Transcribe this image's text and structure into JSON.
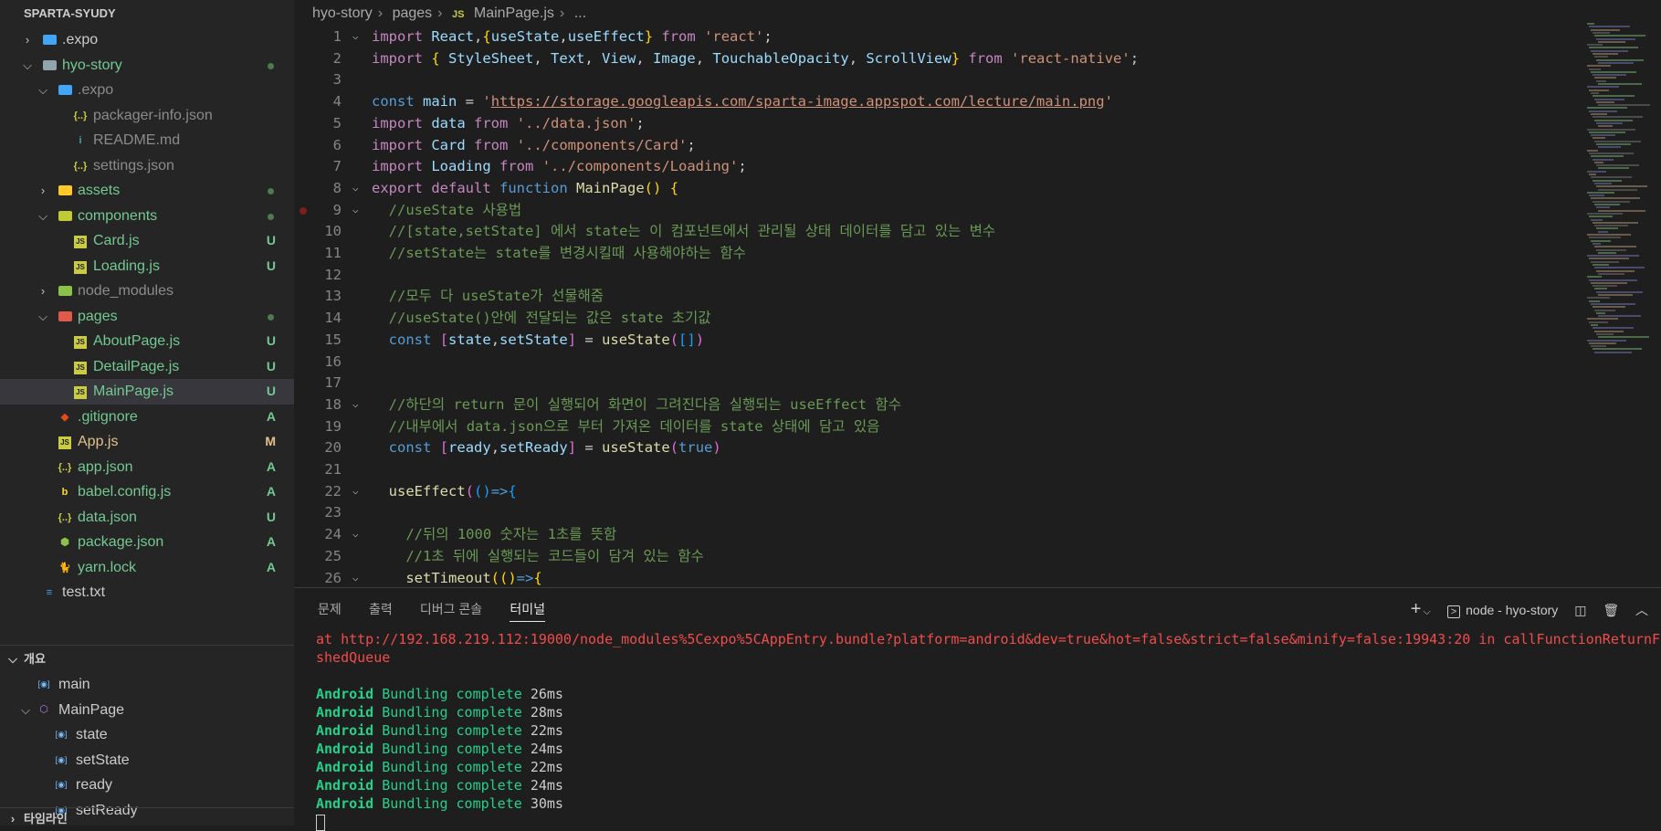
{
  "explorer": {
    "title": "SPARTA-SYUDY",
    "items": [
      {
        "label": ".expo",
        "depth": 1,
        "type": "folder",
        "open": false,
        "color": "white",
        "icon": "expo-folder-icon"
      },
      {
        "label": "hyo-story",
        "depth": 1,
        "type": "folder",
        "open": true,
        "color": "green",
        "dot": true,
        "icon": "folder-icon"
      },
      {
        "label": ".expo",
        "depth": 2,
        "type": "folder",
        "open": true,
        "color": "gray",
        "icon": "expo-folder-icon"
      },
      {
        "label": "packager-info.json",
        "depth": 3,
        "type": "file",
        "color": "gray",
        "icon": "json-icon",
        "glyph": "{..}"
      },
      {
        "label": "README.md",
        "depth": 3,
        "type": "file",
        "color": "gray",
        "icon": "info-icon",
        "glyph": "i"
      },
      {
        "label": "settings.json",
        "depth": 3,
        "type": "file",
        "color": "gray",
        "icon": "json-icon",
        "glyph": "{..}"
      },
      {
        "label": "assets",
        "depth": 2,
        "type": "folder",
        "open": false,
        "color": "green",
        "dot": true,
        "icon": "assets-folder-icon"
      },
      {
        "label": "components",
        "depth": 2,
        "type": "folder",
        "open": true,
        "color": "green",
        "dot": true,
        "icon": "components-folder-icon"
      },
      {
        "label": "Card.js",
        "depth": 3,
        "type": "file",
        "color": "green",
        "status": "U",
        "icon": "js-icon",
        "glyph": "JS"
      },
      {
        "label": "Loading.js",
        "depth": 3,
        "type": "file",
        "color": "green",
        "status": "U",
        "icon": "js-icon",
        "glyph": "JS"
      },
      {
        "label": "node_modules",
        "depth": 2,
        "type": "folder",
        "open": false,
        "color": "gray",
        "icon": "node-modules-folder-icon"
      },
      {
        "label": "pages",
        "depth": 2,
        "type": "folder",
        "open": true,
        "color": "green",
        "dot": true,
        "icon": "pages-folder-icon"
      },
      {
        "label": "AboutPage.js",
        "depth": 3,
        "type": "file",
        "color": "green",
        "status": "U",
        "icon": "js-icon",
        "glyph": "JS"
      },
      {
        "label": "DetailPage.js",
        "depth": 3,
        "type": "file",
        "color": "green",
        "status": "U",
        "icon": "js-icon",
        "glyph": "JS"
      },
      {
        "label": "MainPage.js",
        "depth": 3,
        "type": "file",
        "color": "green",
        "status": "U",
        "icon": "js-icon",
        "glyph": "JS",
        "selected": true
      },
      {
        "label": ".gitignore",
        "depth": 2,
        "type": "file",
        "color": "green",
        "status": "A",
        "icon": "git-icon",
        "glyph": "◆"
      },
      {
        "label": "App.js",
        "depth": 2,
        "type": "file",
        "color": "amber",
        "status": "M",
        "icon": "js-icon",
        "glyph": "JS"
      },
      {
        "label": "app.json",
        "depth": 2,
        "type": "file",
        "color": "green",
        "status": "A",
        "icon": "json-icon",
        "glyph": "{..}"
      },
      {
        "label": "babel.config.js",
        "depth": 2,
        "type": "file",
        "color": "green",
        "status": "A",
        "icon": "babel-icon",
        "glyph": "b"
      },
      {
        "label": "data.json",
        "depth": 2,
        "type": "file",
        "color": "green",
        "status": "U",
        "icon": "json-icon",
        "glyph": "{..}"
      },
      {
        "label": "package.json",
        "depth": 2,
        "type": "file",
        "color": "green",
        "status": "A",
        "icon": "nodejs-icon",
        "glyph": "⬢"
      },
      {
        "label": "yarn.lock",
        "depth": 2,
        "type": "file",
        "color": "green",
        "status": "A",
        "icon": "yarn-icon",
        "glyph": "🐈"
      },
      {
        "label": "test.txt",
        "depth": 1,
        "type": "file",
        "color": "white",
        "icon": "text-file-icon",
        "glyph": "≡"
      }
    ]
  },
  "outline": {
    "title": "개요",
    "items": [
      {
        "label": "main",
        "depth": 1
      },
      {
        "label": "MainPage",
        "depth": 1,
        "open": true,
        "kind": "function"
      },
      {
        "label": "state",
        "depth": 2
      },
      {
        "label": "setState",
        "depth": 2
      },
      {
        "label": "ready",
        "depth": 2
      },
      {
        "label": "setReady",
        "depth": 2
      }
    ]
  },
  "timeline": {
    "title": "타임라인"
  },
  "breadcrumb": [
    "hyo-story",
    "pages",
    "MainPage.js",
    "..."
  ],
  "code": [
    {
      "n": 1,
      "fold": true,
      "html": "<span class='k'>import</span> <span class='v'>React</span>,<span class='p'>{</span><span class='v'>useState</span>,<span class='v'>useEffect</span><span class='p'>}</span> <span class='k'>from</span> <span class='s'>'react'</span>;"
    },
    {
      "n": 2,
      "html": "<span class='k'>import</span> <span class='p'>{</span> <span class='v'>StyleSheet</span>, <span class='v'>Text</span>, <span class='v'>View</span>, <span class='v'>Image</span>, <span class='v'>TouchableOpacity</span>, <span class='v'>ScrollView</span><span class='p'>}</span> <span class='k'>from</span> <span class='s'>'react-native'</span>;"
    },
    {
      "n": 3,
      "html": ""
    },
    {
      "n": 4,
      "html": "<span class='b'>const</span> <span class='v'>main</span> = <span class='s'>'</span><span class='u'>https://storage.googleapis.com/sparta-image.appspot.com/lecture/main.png</span><span class='s'>'</span>"
    },
    {
      "n": 5,
      "html": "<span class='k'>import</span> <span class='v'>data</span> <span class='k'>from</span> <span class='s'>'../data.json'</span>;"
    },
    {
      "n": 6,
      "html": "<span class='k'>import</span> <span class='v'>Card</span> <span class='k'>from</span> <span class='s'>'../components/Card'</span>;"
    },
    {
      "n": 7,
      "html": "<span class='k'>import</span> <span class='v'>Loading</span> <span class='k'>from</span> <span class='s'>'../components/Loading'</span>;"
    },
    {
      "n": 8,
      "fold": true,
      "html": "<span class='k'>export</span> <span class='k'>default</span> <span class='b'>function</span> <span class='f'>MainPage</span><span class='p'>()</span> <span class='p'>{</span>"
    },
    {
      "n": 9,
      "fold": true,
      "bp": true,
      "html": "  <span class='c'>//useState 사용법</span>"
    },
    {
      "n": 10,
      "html": "  <span class='c'>//[state,setState] 에서 state는 이 컴포넌트에서 관리될 상태 데이터를 담고 있는 변수</span>"
    },
    {
      "n": 11,
      "html": "  <span class='c'>//setState는 state를 변경시킬때 사용해야하는 함수</span>"
    },
    {
      "n": 12,
      "html": ""
    },
    {
      "n": 13,
      "html": "  <span class='c'>//모두 다 useState가 선물해줌</span>"
    },
    {
      "n": 14,
      "html": "  <span class='c'>//useState()안에 전달되는 값은 state 초기값</span>"
    },
    {
      "n": 15,
      "html": "  <span class='b'>const</span> <span class='p2'>[</span><span class='v'>state</span>,<span class='v'>setState</span><span class='p2'>]</span> = <span class='f'>useState</span><span class='p2'>(</span><span class='p3'>[]</span><span class='p2'>)</span>"
    },
    {
      "n": 16,
      "html": ""
    },
    {
      "n": 17,
      "html": ""
    },
    {
      "n": 18,
      "fold": true,
      "html": "  <span class='c'>//하단의 return 문이 실행되어 화면이 그려진다음 실행되는 useEffect 함수</span>"
    },
    {
      "n": 19,
      "html": "  <span class='c'>//내부에서 data.json으로 부터 가져온 데이터를 state 상태에 담고 있음</span>"
    },
    {
      "n": 20,
      "html": "  <span class='b'>const</span> <span class='p2'>[</span><span class='v'>ready</span>,<span class='v'>setReady</span><span class='p2'>]</span> = <span class='f'>useState</span><span class='p2'>(</span><span class='b'>true</span><span class='p2'>)</span>"
    },
    {
      "n": 21,
      "html": ""
    },
    {
      "n": 22,
      "fold": true,
      "html": "  <span class='f'>useEffect</span><span class='p2'>(</span><span class='p3'>()</span><span class='b'>=></span><span class='p3'>{</span>"
    },
    {
      "n": 23,
      "html": ""
    },
    {
      "n": 24,
      "fold": true,
      "html": "    <span class='c'>//뒤의 1000 숫자는 1초를 뜻함</span>"
    },
    {
      "n": 25,
      "html": "    <span class='c'>//1초 뒤에 실행되는 코드들이 담겨 있는 함수</span>"
    },
    {
      "n": 26,
      "fold": true,
      "html": "    <span class='f'>setTimeout</span><span class='p'>(()</span><span class='b'>=></span><span class='p'>{</span>"
    }
  ],
  "panel": {
    "tabs": [
      "문제",
      "출력",
      "디버그 콘솔",
      "터미널"
    ],
    "active_tab": "터미널",
    "terminal_name": "node - hyo-story",
    "error_lines": [
      "at http://192.168.219.112:19000/node_modules%5Cexpo%5CAppEntry.bundle?platform=android&dev=true&hot=false&strict=false&minify=false:19943:20 in callFunctionReturnFl",
      "shedQueue"
    ],
    "bundles": [
      {
        "platform": "Android",
        "message": "Bundling complete",
        "time": "26ms"
      },
      {
        "platform": "Android",
        "message": "Bundling complete",
        "time": "28ms"
      },
      {
        "platform": "Android",
        "message": "Bundling complete",
        "time": "22ms"
      },
      {
        "platform": "Android",
        "message": "Bundling complete",
        "time": "24ms"
      },
      {
        "platform": "Android",
        "message": "Bundling complete",
        "time": "22ms"
      },
      {
        "platform": "Android",
        "message": "Bundling complete",
        "time": "24ms"
      },
      {
        "platform": "Android",
        "message": "Bundling complete",
        "time": "30ms"
      }
    ]
  },
  "colors": {
    "editor_bg": "#1e1e1e",
    "sidebar_bg": "#252526",
    "git_untracked": "#73c991",
    "git_modified": "#e2c08d",
    "terminal_error": "#f14c4c",
    "terminal_success": "#23d18b"
  }
}
